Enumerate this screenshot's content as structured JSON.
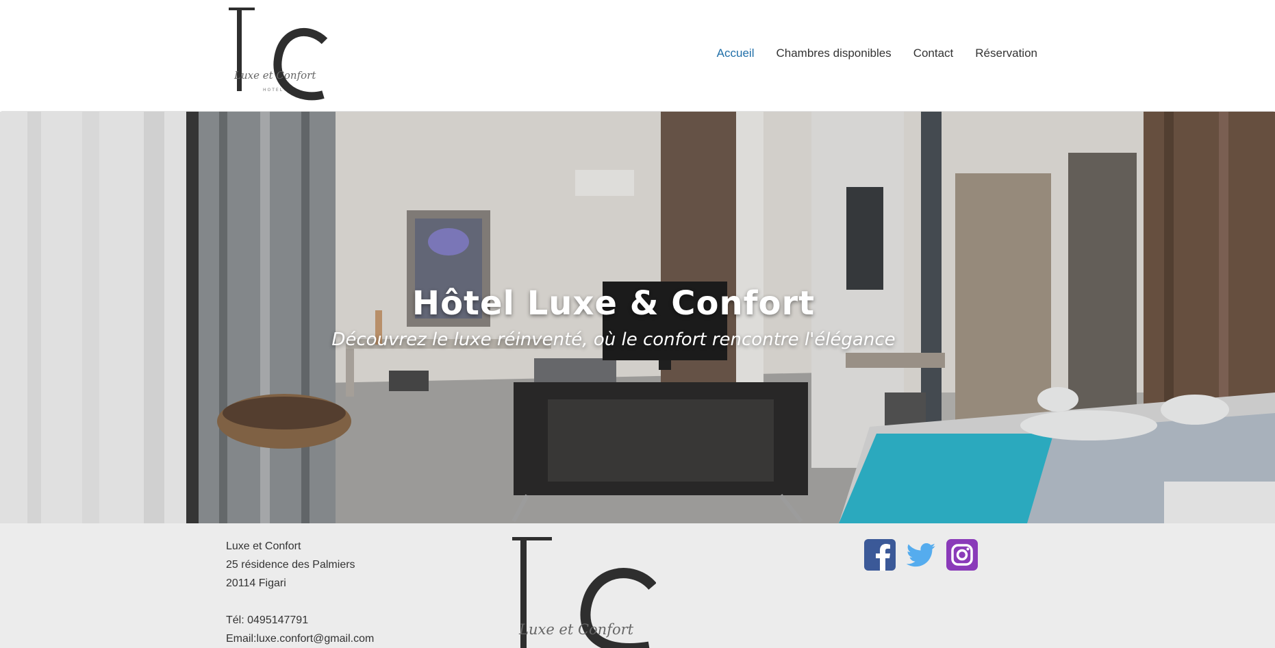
{
  "brand": {
    "logo_initials": "Lc",
    "logo_script": "Luxe et Confort",
    "logo_small": "HOTEL"
  },
  "nav": {
    "items": [
      {
        "label": "Accueil",
        "active": true
      },
      {
        "label": "Chambres disponibles",
        "active": false
      },
      {
        "label": "Contact",
        "active": false
      },
      {
        "label": "Réservation",
        "active": false
      }
    ]
  },
  "hero": {
    "title": "Hôtel Luxe & Confort",
    "subtitle": "Découvrez le luxe réinventé, où le confort rencontre l'élégance"
  },
  "footer": {
    "name": "Luxe et Confort",
    "street": "25 résidence des Palmiers",
    "city": "20114 Figari",
    "phone": "Tél: 0495147791",
    "email": "Email:luxe.confort@gmail.com"
  },
  "social": {
    "icons": [
      "facebook-icon",
      "twitter-icon",
      "instagram-icon"
    ],
    "colors": {
      "facebook": "#3b5998",
      "twitter": "#55acee",
      "instagram": "#8a3ab9"
    }
  },
  "colors": {
    "nav_active": "#1f6ea8",
    "nav_text": "#333333",
    "footer_bg": "#ececec"
  }
}
